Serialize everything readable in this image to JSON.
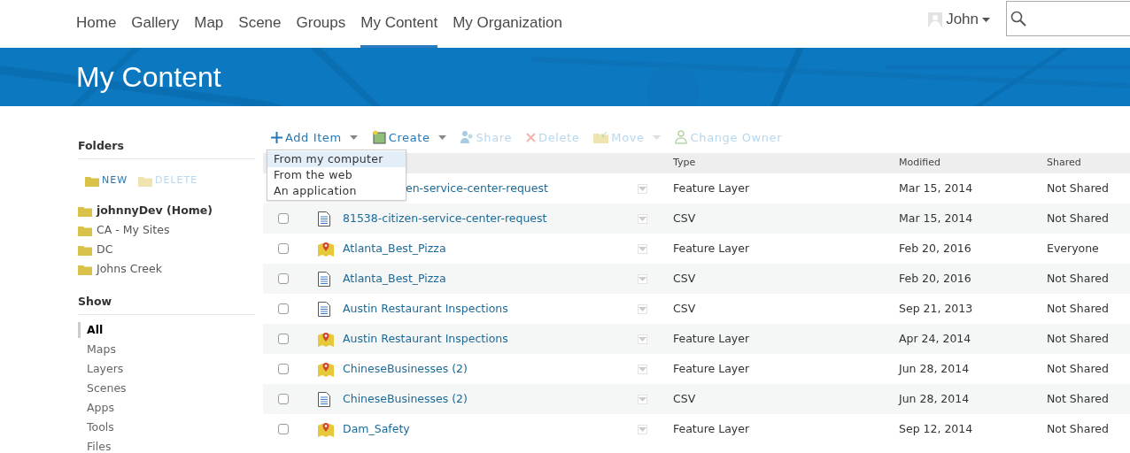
{
  "nav": {
    "items": [
      {
        "label": "Home",
        "selected": false
      },
      {
        "label": "Gallery",
        "selected": false
      },
      {
        "label": "Map",
        "selected": false
      },
      {
        "label": "Scene",
        "selected": false
      },
      {
        "label": "Groups",
        "selected": false
      },
      {
        "label": "My Content",
        "selected": true
      },
      {
        "label": "My Organization",
        "selected": false
      }
    ],
    "user": "John"
  },
  "banner": {
    "title": "My Content"
  },
  "sidebar": {
    "folders_heading": "Folders",
    "folder_actions": [
      {
        "label": "NEW",
        "disabled": false
      },
      {
        "label": "DELETE",
        "disabled": true
      }
    ],
    "folders": [
      {
        "label": "johnnyDev (Home)",
        "selected": true
      },
      {
        "label": "CA - My Sites",
        "selected": false
      },
      {
        "label": "DC",
        "selected": false
      },
      {
        "label": "Johns Creek",
        "selected": false
      }
    ],
    "show_heading": "Show",
    "show": [
      {
        "label": "All",
        "selected": true
      },
      {
        "label": "Maps",
        "selected": false
      },
      {
        "label": "Layers",
        "selected": false
      },
      {
        "label": "Scenes",
        "selected": false
      },
      {
        "label": "Apps",
        "selected": false
      },
      {
        "label": "Tools",
        "selected": false
      },
      {
        "label": "Files",
        "selected": false
      }
    ]
  },
  "toolbar": [
    {
      "kind": "add",
      "label": "Add Item",
      "disabled": false,
      "caret": true
    },
    {
      "kind": "create",
      "label": "Create",
      "disabled": false,
      "caret": true
    },
    {
      "kind": "share",
      "label": "Share",
      "disabled": true,
      "caret": false
    },
    {
      "kind": "delete",
      "label": "Delete",
      "disabled": true,
      "caret": false
    },
    {
      "kind": "move",
      "label": "Move",
      "disabled": true,
      "caret": true
    },
    {
      "kind": "owner",
      "label": "Change Owner",
      "disabled": true,
      "caret": false
    }
  ],
  "add_menu": [
    {
      "label": "From my computer",
      "selected": true
    },
    {
      "label": "From the web",
      "selected": false
    },
    {
      "label": "An application",
      "selected": false
    }
  ],
  "table": {
    "columns": [
      "Type",
      "Modified",
      "Shared"
    ],
    "rows": [
      {
        "title": "en-service-center-request",
        "type": "Feature Layer",
        "modified": "Mar 15, 2014",
        "shared": "Not Shared"
      },
      {
        "kind": "csv",
        "checked": false,
        "title": "81538-citizen-service-center-request",
        "type": "CSV",
        "modified": "Mar 15, 2014",
        "shared": "Not Shared"
      },
      {
        "kind": "layer",
        "checked": false,
        "title": "Atlanta_Best_Pizza",
        "type": "Feature Layer",
        "modified": "Feb 20, 2016",
        "shared": "Everyone"
      },
      {
        "kind": "csv",
        "checked": false,
        "title": "Atlanta_Best_Pizza",
        "type": "CSV",
        "modified": "Feb 20, 2016",
        "shared": "Not Shared"
      },
      {
        "kind": "csv",
        "checked": false,
        "title": "Austin Restaurant Inspections",
        "type": "CSV",
        "modified": "Sep 21, 2013",
        "shared": "Not Shared"
      },
      {
        "kind": "layer",
        "checked": false,
        "title": "Austin Restaurant Inspections",
        "type": "Feature Layer",
        "modified": "Apr 24, 2014",
        "shared": "Not Shared"
      },
      {
        "kind": "layer",
        "checked": false,
        "title": "ChineseBusinesses (2)",
        "type": "Feature Layer",
        "modified": "Jun 28, 2014",
        "shared": "Not Shared"
      },
      {
        "kind": "csv",
        "checked": false,
        "title": "ChineseBusinesses (2)",
        "type": "CSV",
        "modified": "Jun 28, 2014",
        "shared": "Not Shared"
      },
      {
        "kind": "layer",
        "checked": false,
        "title": "Dam_Safety",
        "type": "Feature Layer",
        "modified": "Sep 12, 2014",
        "shared": "Not Shared"
      }
    ]
  }
}
